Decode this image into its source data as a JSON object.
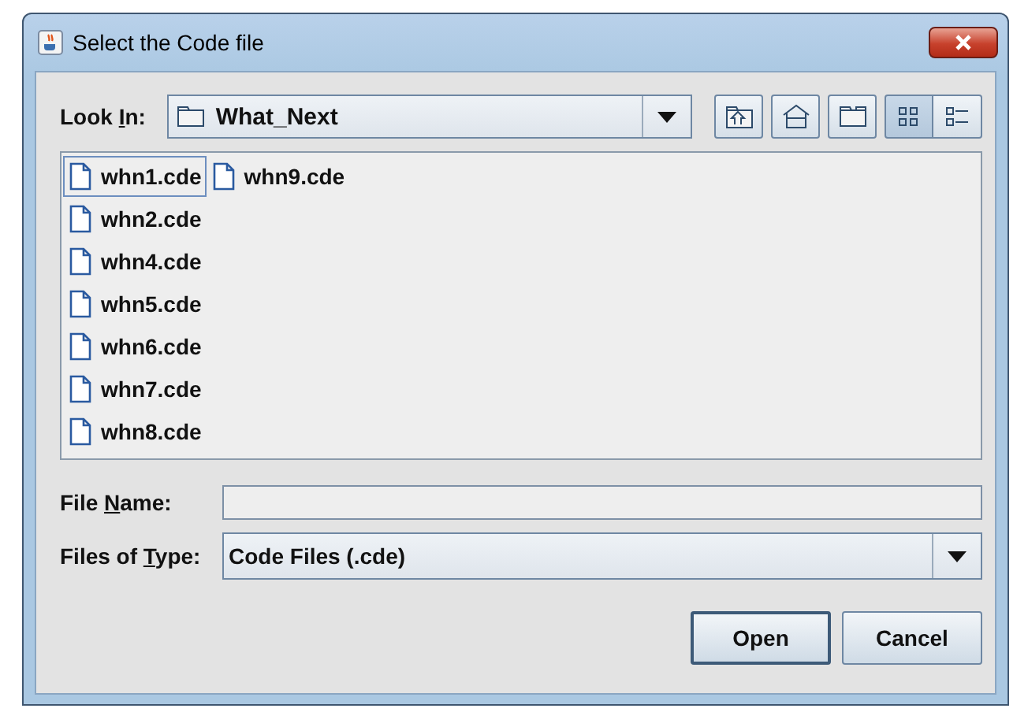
{
  "window": {
    "title": "Select the Code file"
  },
  "look_in": {
    "label_parts": [
      "Look ",
      "I",
      "n:"
    ],
    "value": "What_Next"
  },
  "toolbar": [
    {
      "kind": "up"
    },
    {
      "kind": "home"
    },
    {
      "kind": "new-folder"
    },
    {
      "kind": "list",
      "selected": true
    },
    {
      "kind": "details",
      "selected": false
    }
  ],
  "files": [
    {
      "name": "whn1.cde",
      "selected": true
    },
    {
      "name": "whn2.cde",
      "selected": false
    },
    {
      "name": "whn4.cde",
      "selected": false
    },
    {
      "name": "whn5.cde",
      "selected": false
    },
    {
      "name": "whn6.cde",
      "selected": false
    },
    {
      "name": "whn7.cde",
      "selected": false
    },
    {
      "name": "whn8.cde",
      "selected": false
    },
    {
      "name": "whn9.cde",
      "selected": false
    }
  ],
  "file_name": {
    "label_parts": [
      "File ",
      "N",
      "ame:"
    ]
  },
  "file_type": {
    "label_parts": [
      "Files of ",
      "T",
      "ype:"
    ],
    "value": "Code Files (.cde)"
  },
  "buttons": [
    "Open",
    "Cancel"
  ]
}
